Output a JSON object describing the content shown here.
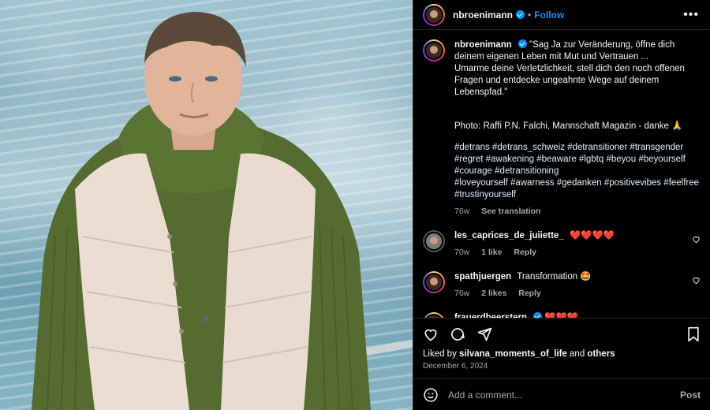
{
  "post": {
    "author": "nbroenimann",
    "follow_label": "Follow",
    "more_label": "•••",
    "dot": "•",
    "caption": {
      "username": "nbroenimann",
      "text": "\"Sag Ja zur Veränderung, öffne dich deinem eigenen Leben mit Mut und Vertrauen ...\nUmarme deine Verletzlichkeit, stell dich den noch offenen Fragen und entdecke ungeahnte Wege auf deinem Lebenspfad.\"",
      "credit": "Photo: Raffi P.N. Falchi, Mannschaft Magazin - danke 🙏",
      "hashtags_1": "#detrans #detrans_schweiz #detransitioner #transgender #regret #awakening #beaware #lgbtq #beyou #beyourself #courage #detransitioning",
      "hashtags_2": "#loveyourself #awarness #gedanken #positivevibes #feelfree #trustinyourself",
      "time": "76w",
      "translation_label": "See translation"
    },
    "comments": [
      {
        "username": "les_caprices_de_juiiette_",
        "text": "❤️❤️❤️❤️",
        "time": "70w",
        "likes": "1 like",
        "reply": "Reply"
      },
      {
        "username": "spathjuergen",
        "text": "Transformation 🤩",
        "time": "76w",
        "likes": "2 likes",
        "reply": "Reply"
      },
      {
        "username": "frauerdbeerstern",
        "text": "❤️❤️❤️",
        "time": "",
        "likes": "",
        "reply": ""
      }
    ],
    "liked_by_prefix": "Liked by",
    "liked_by_user": "silvana_moments_of_life",
    "liked_by_and": "and",
    "liked_by_others": "others",
    "date": "December 6, 2024",
    "comment_placeholder": "Add a comment...",
    "post_label": "Post"
  },
  "colors": {
    "accent": "#0095f6",
    "background": "#000000",
    "muted": "#a8a8a8"
  },
  "icons": [
    "heart-icon",
    "comment-icon",
    "share-icon",
    "bookmark-icon",
    "emoji-icon",
    "verified-icon",
    "more-icon"
  ]
}
